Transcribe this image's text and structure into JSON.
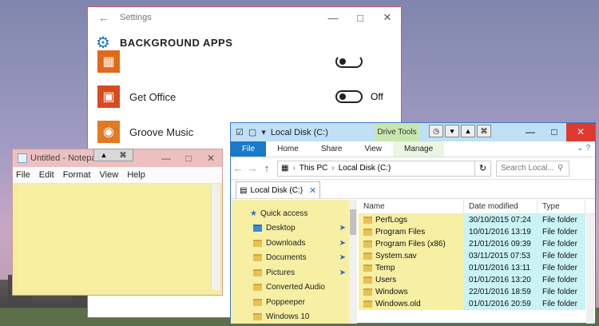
{
  "settings_window": {
    "title": "Settings",
    "back_icon": "arrow-left-icon",
    "header_icon": "gear-icon",
    "section_title": "BACKGROUND APPS",
    "apps": [
      {
        "name": "",
        "icon": "calendar-icon",
        "color": "#e06a1a",
        "toggle_label": ""
      },
      {
        "name": "Get Office",
        "icon": "office-icon",
        "color": "#d64b1f",
        "toggle_label": "Off"
      },
      {
        "name": "Groove Music",
        "icon": "groove-music-icon",
        "color": "#e07a23",
        "toggle_label": ""
      }
    ]
  },
  "notepad": {
    "title": "Untitled - Notepad",
    "menu": [
      "File",
      "Edit",
      "Format",
      "View",
      "Help"
    ]
  },
  "explorer": {
    "title": "Local Disk (C:)",
    "contextual_tab": "Drive Tools",
    "ribbon_tabs": [
      "File",
      "Home",
      "Share",
      "View",
      "Manage"
    ],
    "address": [
      "This PC",
      "Local Disk (C:)"
    ],
    "search_placeholder": "Search Local...",
    "open_tab": "Local Disk (C:)",
    "nav_items": [
      {
        "label": "Quick access",
        "icon": "star-icon",
        "pinned": false
      },
      {
        "label": "Desktop",
        "icon": "desktop-folder-icon",
        "pinned": true
      },
      {
        "label": "Downloads",
        "icon": "downloads-folder-icon",
        "pinned": true
      },
      {
        "label": "Documents",
        "icon": "documents-folder-icon",
        "pinned": true
      },
      {
        "label": "Pictures",
        "icon": "pictures-folder-icon",
        "pinned": true
      },
      {
        "label": "Converted Audio",
        "icon": "folder-icon",
        "pinned": false
      },
      {
        "label": "Poppeeper",
        "icon": "folder-icon",
        "pinned": false
      },
      {
        "label": "Windows 10",
        "icon": "folder-icon",
        "pinned": false
      }
    ],
    "columns": [
      "Name",
      "Date modified",
      "Type"
    ],
    "files": [
      {
        "name": "PerfLogs",
        "date": "30/10/2015 07:24",
        "type": "File folder"
      },
      {
        "name": "Program Files",
        "date": "10/01/2016 13:19",
        "type": "File folder"
      },
      {
        "name": "Program Files (x86)",
        "date": "21/01/2016 09:39",
        "type": "File folder"
      },
      {
        "name": "System.sav",
        "date": "03/11/2015 07:53",
        "type": "File folder"
      },
      {
        "name": "Temp",
        "date": "01/01/2016 13:11",
        "type": "File folder"
      },
      {
        "name": "Users",
        "date": "01/01/2016 13:20",
        "type": "File folder"
      },
      {
        "name": "Windows",
        "date": "22/01/2016 18:59",
        "type": "File folder"
      },
      {
        "name": "Windows.old",
        "date": "01/01/2016 20:59",
        "type": "File folder"
      }
    ]
  }
}
